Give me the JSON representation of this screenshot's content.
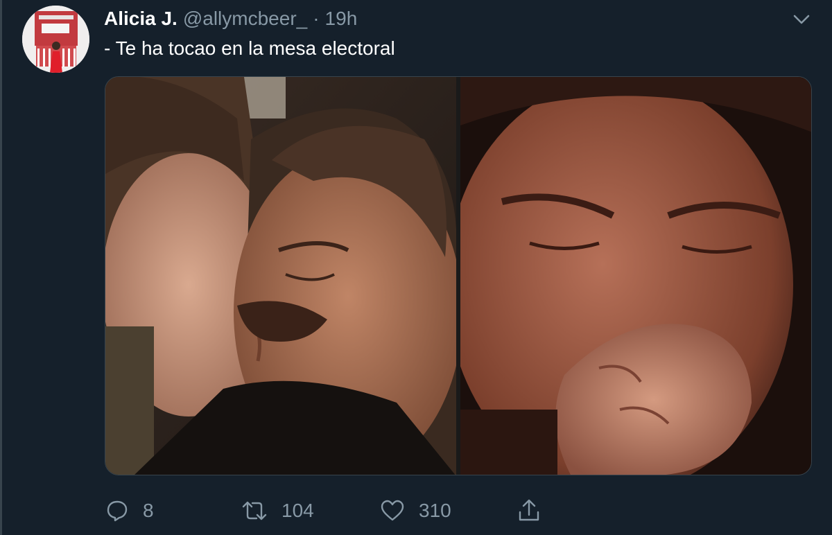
{
  "tweet": {
    "display_name": "Alicia J.",
    "handle": "@allymcbeer_",
    "separator": "·",
    "time": "19h",
    "text": "- Te ha tocao en la mesa electoral"
  },
  "actions": {
    "reply_count": "8",
    "retweet_count": "104",
    "like_count": "310"
  },
  "icons": {
    "more": "chevron-down-icon",
    "reply": "reply-icon",
    "retweet": "retweet-icon",
    "like": "heart-icon",
    "share": "share-icon"
  },
  "colors": {
    "background": "#15202b",
    "secondary_text": "#8899a6",
    "border": "#38444d"
  }
}
